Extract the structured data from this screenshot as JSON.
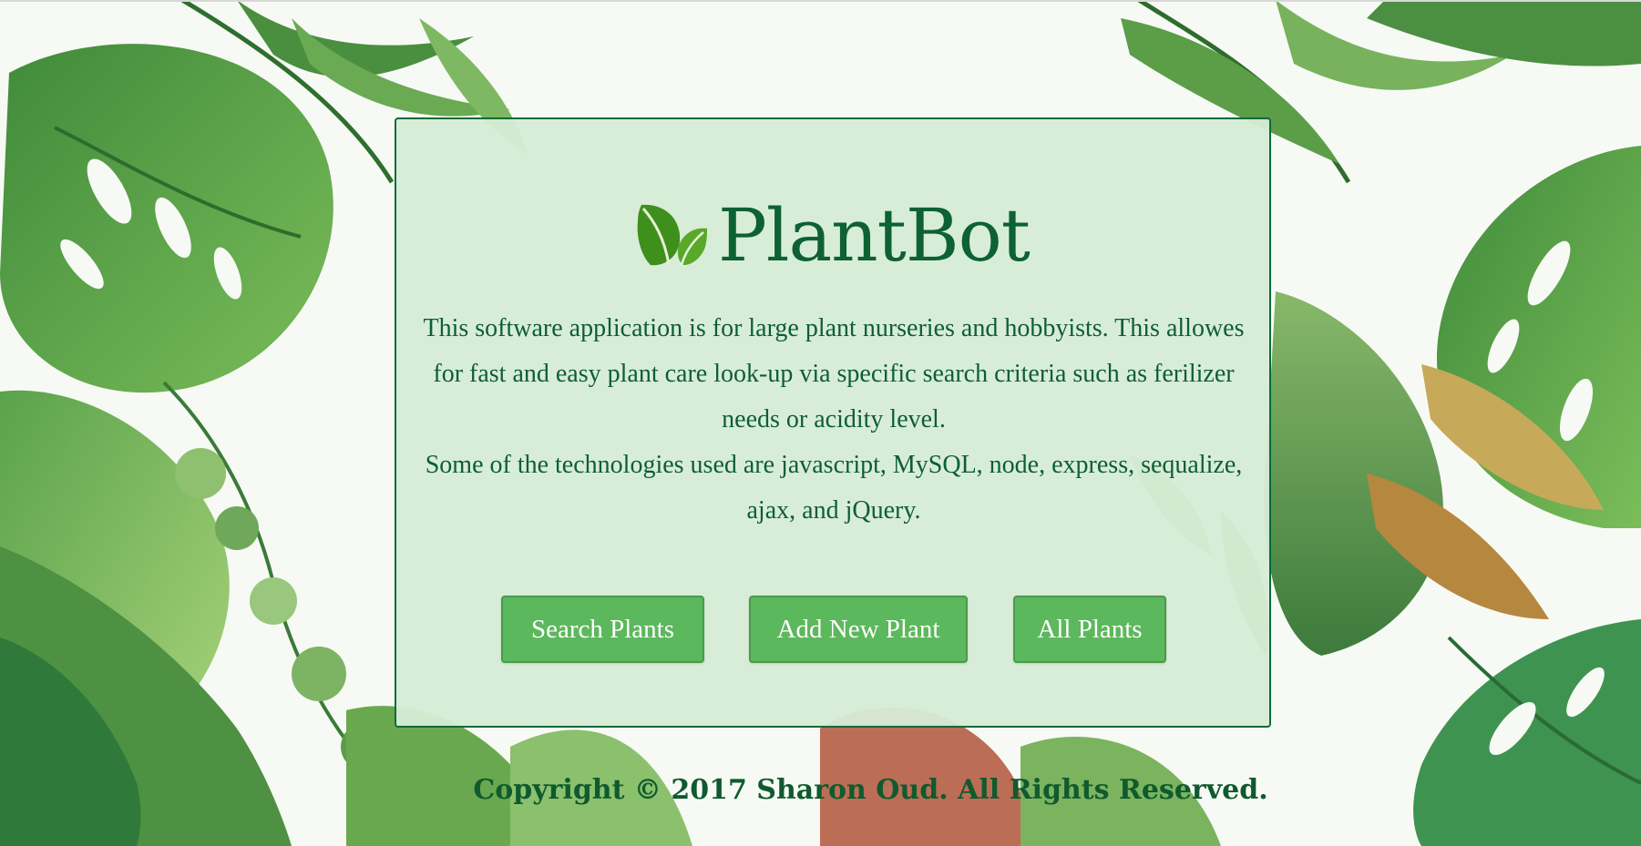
{
  "app": {
    "title": "PlantBot"
  },
  "description": {
    "paragraph1": "This software application is for large plant nurseries and hobbyists. This allowes for fast and easy plant care look-up via specific search criteria such as ferilizer needs or acidity level.",
    "paragraph2": "Some of the technologies used are javascript, MySQL, node, express, sequalize, ajax, and jQuery."
  },
  "buttons": {
    "search_label": "Search Plants",
    "add_label": "Add New Plant",
    "all_label": "All Plants"
  },
  "footer": {
    "copyright": "Copyright © 2017 Sharon Oud. All Rights Reserved."
  },
  "colors": {
    "brand_green": "#0d6133",
    "button_green": "#5cb85c",
    "panel_bg": "#d6ecd6",
    "panel_border": "#0a6a3a"
  },
  "icons": {
    "logo": "leaf-icon",
    "background": "tropical-foliage-illustration"
  }
}
